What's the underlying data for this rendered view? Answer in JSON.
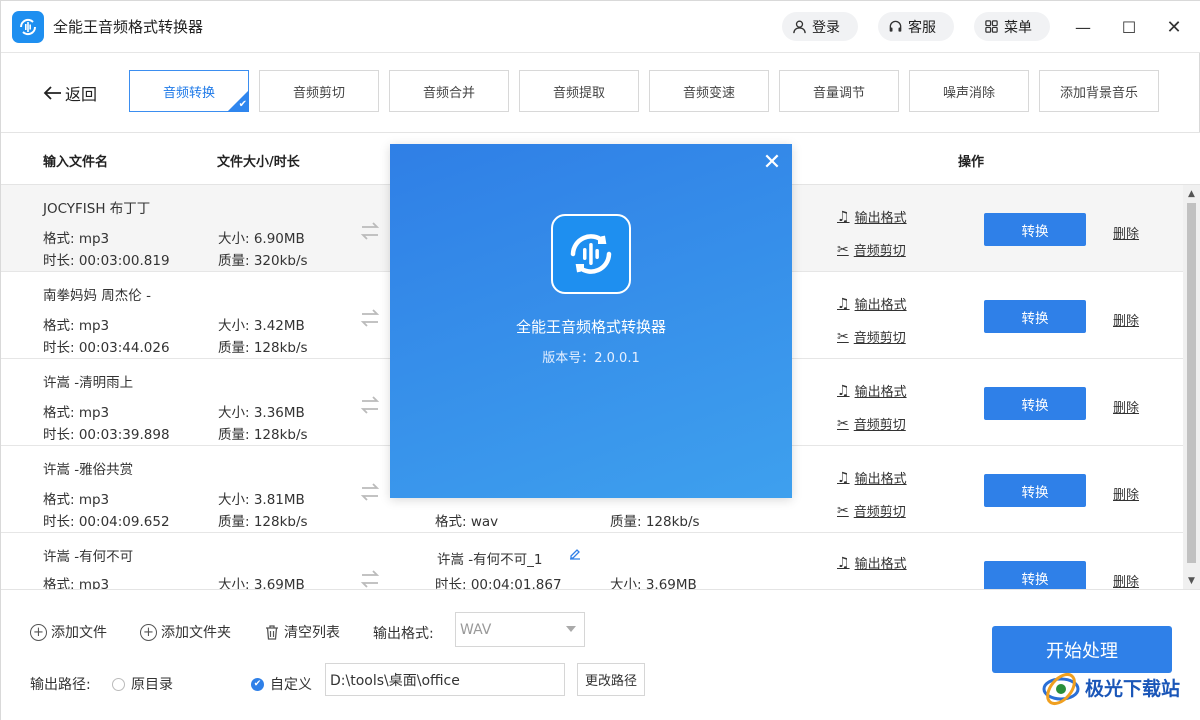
{
  "app": {
    "title": "全能王音频格式转换器"
  },
  "titlebar": {
    "login_label": "登录",
    "service_label": "客服",
    "menu_label": "菜单",
    "minimize": "—",
    "maximize": "☐",
    "close": "✕"
  },
  "nav": {
    "back_label": "返回",
    "tabs": [
      {
        "label": "音频转换",
        "active": true
      },
      {
        "label": "音频剪切"
      },
      {
        "label": "音频合并"
      },
      {
        "label": "音频提取"
      },
      {
        "label": "音频变速"
      },
      {
        "label": "音量调节"
      },
      {
        "label": "噪声消除"
      },
      {
        "label": "添加背景音乐"
      }
    ]
  },
  "table": {
    "headers": {
      "input_name": "输入文件名",
      "size_duration": "文件大小/时长",
      "actions": "操作"
    },
    "rows": [
      {
        "name": "JOCYFISH 布丁丁",
        "format": "格式: mp3",
        "duration": "时长: 00:03:00.819",
        "size": "大小: 6.90MB",
        "quality": "质量: 320kb/s"
      },
      {
        "name": "南拳妈妈 周杰伦 -",
        "format": "格式: mp3",
        "duration": "时长: 00:03:44.026",
        "size": "大小: 3.42MB",
        "quality": "质量: 128kb/s"
      },
      {
        "name": "许嵩 -清明雨上",
        "format": "格式: mp3",
        "duration": "时长: 00:03:39.898",
        "size": "大小: 3.36MB",
        "quality": "质量: 128kb/s"
      },
      {
        "name": "许嵩 -雅俗共赏",
        "format": "格式: mp3",
        "duration": "时长: 00:04:09.652",
        "size": "大小: 3.81MB",
        "quality": "质量: 128kb/s",
        "out_format": "格式: wav",
        "out_quality": "质量: 128kb/s"
      },
      {
        "name": "许嵩 -有何不可",
        "format": "格式: mp3",
        "duration": "",
        "size": "大小: 3.69MB",
        "quality": "",
        "out_name": "许嵩 -有何不可_1",
        "out_duration": "时长: 00:04:01.867",
        "out_size": "大小: 3.69MB"
      }
    ],
    "output_format_link": "输出格式",
    "audio_cut_link": "音频剪切",
    "convert_label": "转换",
    "delete_label": "删除"
  },
  "bottom": {
    "add_file": "添加文件",
    "add_folder": "添加文件夹",
    "clear_list": "清空列表",
    "output_format_label": "输出格式:",
    "output_format_value": "WAV",
    "output_path_label": "输出路径:",
    "radio_original": "原目录",
    "radio_custom": "自定义",
    "path_value": "D:\\tools\\桌面\\office",
    "change_path": "更改路径",
    "start_label": "开始处理"
  },
  "watermark": {
    "text": "极光下载站"
  },
  "splash": {
    "title": "全能王音频格式转换器",
    "version": "版本号：2.0.0.1",
    "close": "✕"
  },
  "colors": {
    "accent": "#2f80e8",
    "splash_top": "#2f7fe6",
    "splash_bottom": "#3ea0ee"
  }
}
